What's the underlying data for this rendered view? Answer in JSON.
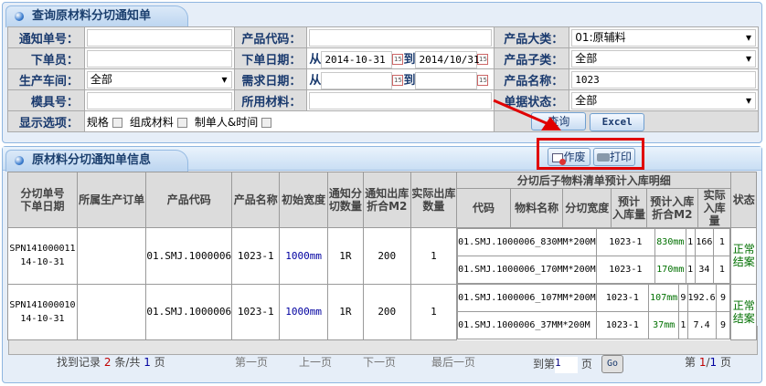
{
  "query_panel": {
    "title": "查询原材料分切通知单",
    "labels": {
      "notice_no": "通知单号：",
      "product_code": "产品代码：",
      "category": "产品大类：",
      "orderer": "下单员：",
      "order_date": "下单日期：",
      "subcategory": "产品子类：",
      "workshop": "生产车间：",
      "demand_date": "需求日期：",
      "product_name": "产品名称：",
      "mold_no": "模具号：",
      "material_used": "所用材料：",
      "doc_status": "单据状态：",
      "display_options": "显示选项："
    },
    "values": {
      "notice_no": "",
      "product_code": "",
      "category": "01:原辅料",
      "orderer": "",
      "order_date_from": "2014-10-31",
      "order_date_to": "2014/10/31",
      "subcategory": "全部",
      "workshop": "全部",
      "demand_date_from": "",
      "demand_date_to": "",
      "product_name": "1023",
      "mold_no": "",
      "material_used": "",
      "doc_status": "全部"
    },
    "from_label": "从",
    "to_label": "到",
    "options": [
      "规格",
      "组成材料",
      "制单人&时间"
    ],
    "query_button": "查询",
    "excel_button": "Excel"
  },
  "toolbar": {
    "void_button": "作废",
    "print_button": "打印"
  },
  "list_panel": {
    "title": "原材料分切通知单信息",
    "headers": [
      "分切单号\n下单日期",
      "所属生产订单",
      "产品代码",
      "产品名称",
      "初始宽度",
      "通知分\n切数量",
      "通知出库\n折合M2",
      "实际出库\n数量"
    ],
    "group_header": "分切后子物料清单预计入库明细",
    "sub_headers": [
      "代码",
      "物料名称",
      "分切宽度",
      "预计\n入库量",
      "预计入库\n折合M2",
      "实际\n入库量"
    ],
    "status_header": "状态",
    "rows": [
      {
        "no": "SPN141000011",
        "date": "14-10-31",
        "order": "",
        "code": "01.SMJ.1000006",
        "name": "1023-1",
        "width": "1000mm",
        "qty": "1R",
        "m2": "200",
        "actual": "1",
        "status": "正常\n结案",
        "items": [
          {
            "code": "01.SMJ.1000006_830MM*200M",
            "name": "1023-1",
            "width": "830mm",
            "qty": "1",
            "m2": "166",
            "actual": "1"
          },
          {
            "code": "01.SMJ.1000006_170MM*200M",
            "name": "1023-1",
            "width": "170mm",
            "qty": "1",
            "m2": "34",
            "actual": "1"
          }
        ]
      },
      {
        "no": "SPN141000010",
        "date": "14-10-31",
        "order": "",
        "code": "01.SMJ.1000006",
        "name": "1023-1",
        "width": "1000mm",
        "qty": "1R",
        "m2": "200",
        "actual": "1",
        "status": "正常\n结案",
        "items": [
          {
            "code": "01.SMJ.1000006_107MM*200M",
            "name": "1023-1",
            "width": "107mm",
            "qty": "9",
            "m2": "192.6",
            "actual": "9"
          },
          {
            "code": "01.SMJ.1000006_37MM*200M",
            "name": "1023-1",
            "width": "37mm",
            "qty": "1",
            "m2": "7.4",
            "actual": "9"
          }
        ]
      }
    ]
  },
  "pager": {
    "found_prefix": "找到记录",
    "record_count": "2",
    "found_mid": "条/共",
    "page_total": "1",
    "page_suffix": "页",
    "first": "第一页",
    "prev": "上一页",
    "next": "下一页",
    "last": "最后一页",
    "goto_prefix": "到第",
    "goto_value": "1",
    "goto_suffix": "页",
    "go_button": "Go",
    "current_prefix": "第",
    "current_page": "1",
    "current_sep": "/",
    "current_total": "1",
    "current_suffix": "页"
  },
  "colors": {
    "accent": "#1a3a6e",
    "highlight": "#e00000",
    "status": "#007000"
  }
}
